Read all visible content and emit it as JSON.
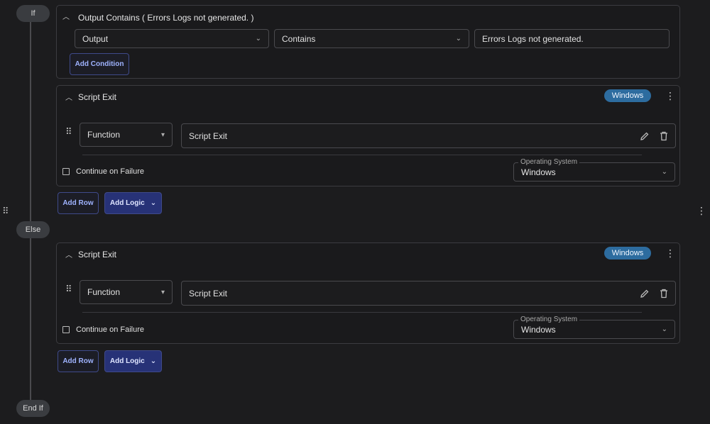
{
  "flow": {
    "if_label": "If",
    "else_label": "Else",
    "endif_label": "End If"
  },
  "condition": {
    "title": "Output Contains ( Errors Logs not generated. )",
    "field": "Output",
    "operator": "Contains",
    "value": "Errors Logs not generated.",
    "add_condition_label": "Add Condition"
  },
  "if_block": {
    "title": "Script Exit",
    "badge": "Windows",
    "type_select": "Function",
    "script_value": "Script Exit",
    "continue_label": "Continue on Failure",
    "os_legend": "Operating System",
    "os_value": "Windows",
    "add_row_label": "Add Row",
    "add_logic_label": "Add Logic"
  },
  "else_block": {
    "title": "Script Exit",
    "badge": "Windows",
    "type_select": "Function",
    "script_value": "Script Exit",
    "continue_label": "Continue on Failure",
    "os_legend": "Operating System",
    "os_value": "Windows",
    "add_row_label": "Add Row",
    "add_logic_label": "Add Logic"
  },
  "icons": {
    "collapse": "chevron-up-icon",
    "dropdown": "chevron-down-icon",
    "edit": "pencil-icon",
    "delete": "trash-icon",
    "more": "kebab-icon",
    "drag": "drag-handle-icon"
  },
  "colors": {
    "background": "#1c1c1e",
    "badge": "#2d6c9f",
    "primary_button": "#273277",
    "accent_text": "#9fb3ff"
  }
}
